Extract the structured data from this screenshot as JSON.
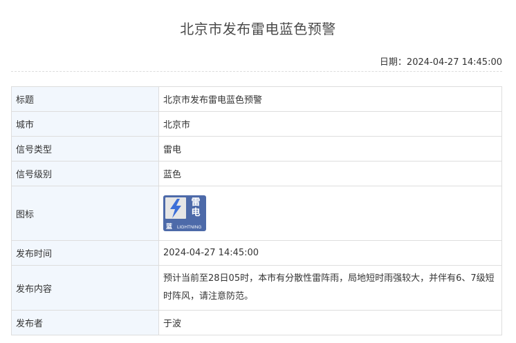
{
  "page": {
    "title": "北京市发布雷电蓝色预警"
  },
  "date": {
    "label": "日期：",
    "value": "2024-04-27 14:45:00"
  },
  "rows": [
    {
      "key": "标题",
      "value": "北京市发布雷电蓝色预警"
    },
    {
      "key": "城市",
      "value": "北京市"
    },
    {
      "key": "信号类型",
      "value": "雷电"
    },
    {
      "key": "信号级别",
      "value": "蓝色"
    },
    {
      "key": "图标"
    },
    {
      "key": "发布时间",
      "value": "2024-04-27 14:45:00"
    },
    {
      "key": "发布内容",
      "value": "预计当前至28日05时，本市有分散性雷阵雨，局地短时雨强较大，并伴有6、7级短时阵风，请注意防范。"
    },
    {
      "key": "发布者",
      "value": "于波"
    }
  ],
  "icon": {
    "name": "lightning-blue-signal-icon",
    "char_top": "雷",
    "char_bottom": "电",
    "level_char": "蓝",
    "english": "LIGHTNING",
    "color": "#4d6aa9"
  }
}
